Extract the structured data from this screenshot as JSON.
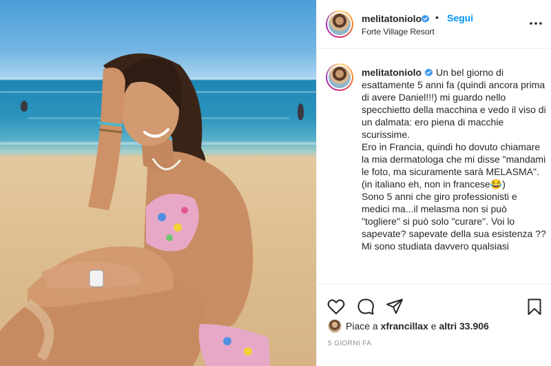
{
  "post": {
    "image_alt": "Woman sitting on a sandy beach with the sea behind her",
    "author": "melitatoniolo",
    "verified": true,
    "separator": "•",
    "follow_label": "Segui",
    "location": "Forte Village Resort",
    "caption": "Un bel giorno di esattamente 5 anni fa (quindi ancora prima di avere Daniel!!!) mi guardo nello specchietto della macchina e vedo il viso di un dalmata: ero piena di macchie scurissime.\nEro in Francia, quindi ho dovuto chiamare la mia dermatologa che mi disse \"mandami le foto, ma sicuramente sarà MELASMA\". (in italiano eh, non in francese😂)\nSono 5 anni che giro professionisti e medici ma...il melasma non si può \"togliere\" si può solo \"curare\". Voi lo sapevate? sapevate della sua esistenza ??\nMi sono studiata davvero qualsiasi",
    "likes_prefix": "Piace a",
    "likes_user": "xfrancillax",
    "likes_middle": "e",
    "likes_others": "altri 33.906",
    "timestamp": "5 giorni fa"
  },
  "icons": {
    "verified": "verified-badge-icon",
    "more": "more-options-icon",
    "like": "heart-icon",
    "comment": "comment-icon",
    "share": "paper-plane-icon",
    "save": "bookmark-icon"
  },
  "colors": {
    "accent": "#0095f6",
    "text": "#262626",
    "muted": "#8e8e8e",
    "border": "#efefef"
  }
}
